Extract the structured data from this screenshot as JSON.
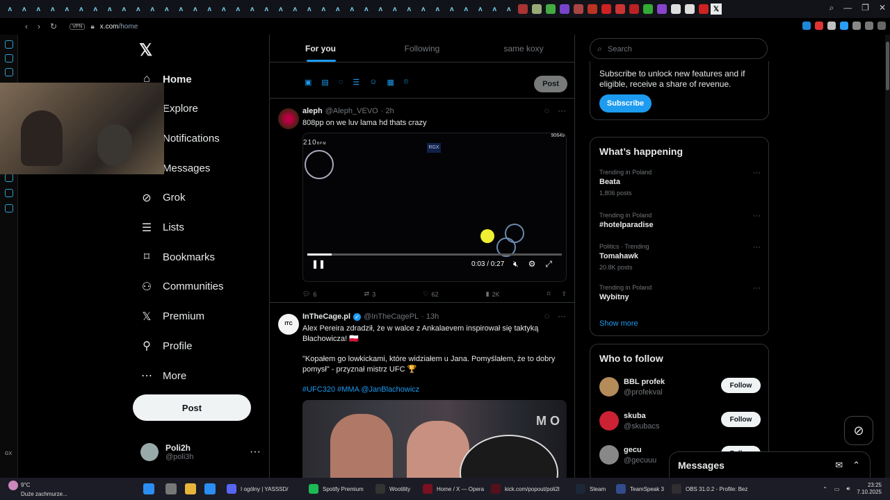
{
  "browser": {
    "url_host": "x.com",
    "url_path": "/home",
    "vpn": "VPN"
  },
  "nav": {
    "items": [
      {
        "label": "Home",
        "icon": "home-icon"
      },
      {
        "label": "Explore",
        "icon": "search-icon"
      },
      {
        "label": "Notifications",
        "icon": "bell-icon"
      },
      {
        "label": "Messages",
        "icon": "envelope-icon"
      },
      {
        "label": "Grok",
        "icon": "grok-icon"
      },
      {
        "label": "Lists",
        "icon": "list-icon"
      },
      {
        "label": "Bookmarks",
        "icon": "bookmark-icon"
      },
      {
        "label": "Communities",
        "icon": "people-icon"
      },
      {
        "label": "Premium",
        "icon": "x-icon"
      },
      {
        "label": "Profile",
        "icon": "person-icon"
      },
      {
        "label": "More",
        "icon": "more-icon"
      }
    ],
    "post_label": "Post",
    "account": {
      "name": "Poli2h",
      "handle": "@poli3h"
    }
  },
  "feed": {
    "tabs": [
      "For you",
      "Following",
      "same koxy"
    ],
    "composer_post": "Post",
    "tweets": [
      {
        "name": "aleph",
        "handle": "@Aleph_VEVO",
        "time": "· 2h",
        "text": "808pp on we luv lama hd thats crazy",
        "video": {
          "bpm": "210",
          "bpm_unit": "BPM",
          "accuracy": "90649",
          "logo": "RGX",
          "time": "0:03 / 0:27",
          "progress": 0.095
        },
        "replies": "6",
        "reposts": "3",
        "likes": "62",
        "views": "2K"
      },
      {
        "name": "InTheCage.pl",
        "handle": "@InTheCagePL",
        "time": "· 13h",
        "text_p1": "Alex Pereira zdradził, że w walce z Ankalaevem inspirował się taktyką Błachowicza! 🇵🇱",
        "text_p2": "\"Kopałem go lowkickami, które widziałem u Jana. Pomyślałem, że to dobry pomysł\" - przyznał mistrz UFC 🏆",
        "hashtags": "#UFC320 #MMA @JanBlachowicz",
        "photo_text": "M O"
      }
    ]
  },
  "sidebar": {
    "search_placeholder": "Search",
    "subscribe_text": "Subscribe to unlock new features and if eligible, receive a share of revenue.",
    "subscribe_label": "Subscribe",
    "happening_title": "What’s happening",
    "trends": [
      {
        "context": "Trending in Poland",
        "title": "Beata",
        "posts": "1,806 posts"
      },
      {
        "context": "Trending in Poland",
        "title": "#hotelparadise",
        "posts": ""
      },
      {
        "context": "Politics · Trending",
        "title": "Tomahawk",
        "posts": "20.8K posts"
      },
      {
        "context": "Trending in Poland",
        "title": "Wybitny",
        "posts": ""
      }
    ],
    "show_more": "Show more",
    "follow_title": "Who to follow",
    "follow": [
      {
        "name": "BBL profek",
        "handle": "@profekval",
        "btn": "Follow"
      },
      {
        "name": "skuba",
        "handle": "@skubacs",
        "btn": "Follow"
      },
      {
        "name": "gecu",
        "handle": "@gecuuu",
        "btn": "Follow"
      }
    ]
  },
  "messages_drawer": {
    "title": "Messages"
  },
  "taskbar": {
    "weather_temp": "9°C",
    "weather_desc": "Duże zachmurze...",
    "apps": [
      "I ogólny | YASSSD/",
      "Spotify Premium",
      "Wootility",
      "Home / X — Opera",
      "kick.com/popout/poli2l",
      "Steam",
      "TeamSpeak 3",
      "OBS 31.0.2 - Profile: Bez"
    ],
    "time": "23:25",
    "date": "7.10.2025"
  }
}
